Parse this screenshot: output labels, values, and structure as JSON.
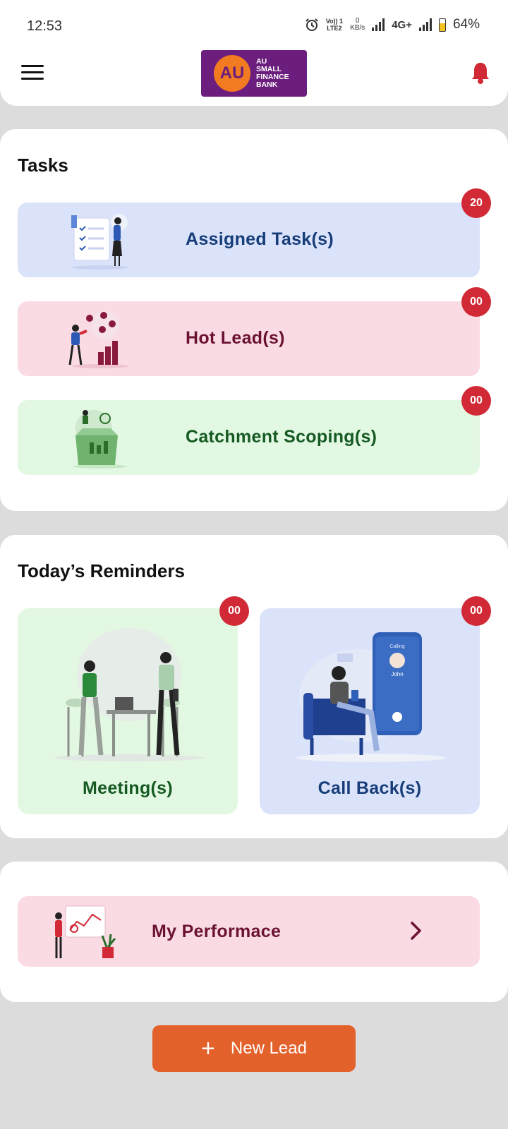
{
  "status_bar": {
    "time": "12:53",
    "volte": "Vo)) 1",
    "lte": "LTE2",
    "kbs_value": "0",
    "kbs_unit": "KB/s",
    "network": "4G+",
    "battery": "64%"
  },
  "header": {
    "logo_mark": "AU",
    "logo_line1": "AU",
    "logo_line2": "SMALL",
    "logo_line3": "FINANCE",
    "logo_line4": "BANK",
    "menu_icon": "hamburger-icon",
    "bell_icon": "bell-icon"
  },
  "tasks": {
    "title": "Tasks",
    "items": [
      {
        "label": "Assigned Task(s)",
        "count": "20",
        "bg": "#dbe3fb",
        "fg": "#173d78"
      },
      {
        "label": "Hot Lead(s)",
        "count": "00",
        "bg": "#fadbe4",
        "fg": "#6b1233"
      },
      {
        "label": "Catchment Scoping(s)",
        "count": "00",
        "bg": "#e2f8e2",
        "fg": "#155a23"
      }
    ]
  },
  "reminders": {
    "title": "Today’s Reminders",
    "items": [
      {
        "label": "Meeting(s)",
        "count": "00",
        "bg": "#e2f8e2",
        "fg": "#155a23"
      },
      {
        "label": "Call Back(s)",
        "count": "00",
        "bg": "#dbe3fb",
        "fg": "#173d78"
      }
    ],
    "phone_caller": "John",
    "phone_status": "Calling"
  },
  "performance": {
    "label": "My Performace",
    "chevron_icon": "chevron-right-icon"
  },
  "new_lead": {
    "label": "New Lead",
    "icon": "plus-icon"
  },
  "colors": {
    "brand_purple": "#6b1e7d",
    "brand_orange": "#f27a21",
    "badge_red": "#d12a36",
    "button_orange": "#e3612a"
  }
}
